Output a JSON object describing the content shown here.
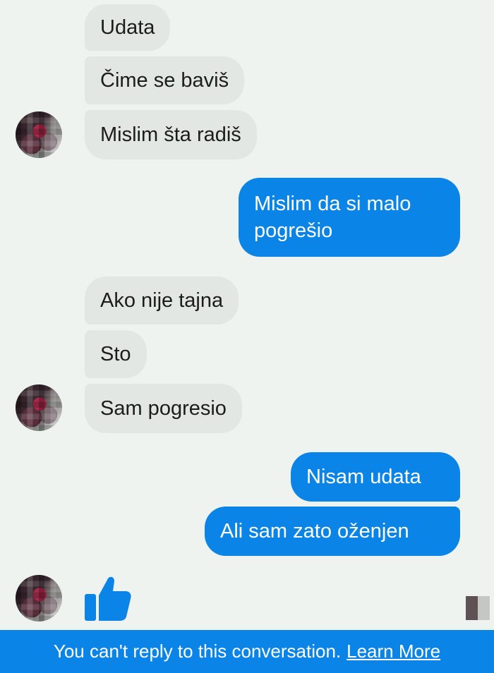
{
  "conversation": {
    "incoming_1": [
      "Udata",
      "Čime se baviš",
      "Mislim šta radiš"
    ],
    "outgoing_1": "Mislim da si malo pogrešio",
    "incoming_2": [
      "Ako nije tajna",
      "Sto",
      "Sam pogresio"
    ],
    "outgoing_2": [
      "Nisam udata",
      "Ali sam zato oženjen"
    ]
  },
  "reaction": {
    "icon": "thumbs-up-icon",
    "color": "#0a84e6"
  },
  "footer": {
    "message": "You can't reply to this conversation.",
    "link": "Learn More"
  },
  "colors": {
    "incoming_bubble": "#e3e7e4",
    "outgoing_bubble": "#0a84e6",
    "background": "#eef3ef"
  }
}
